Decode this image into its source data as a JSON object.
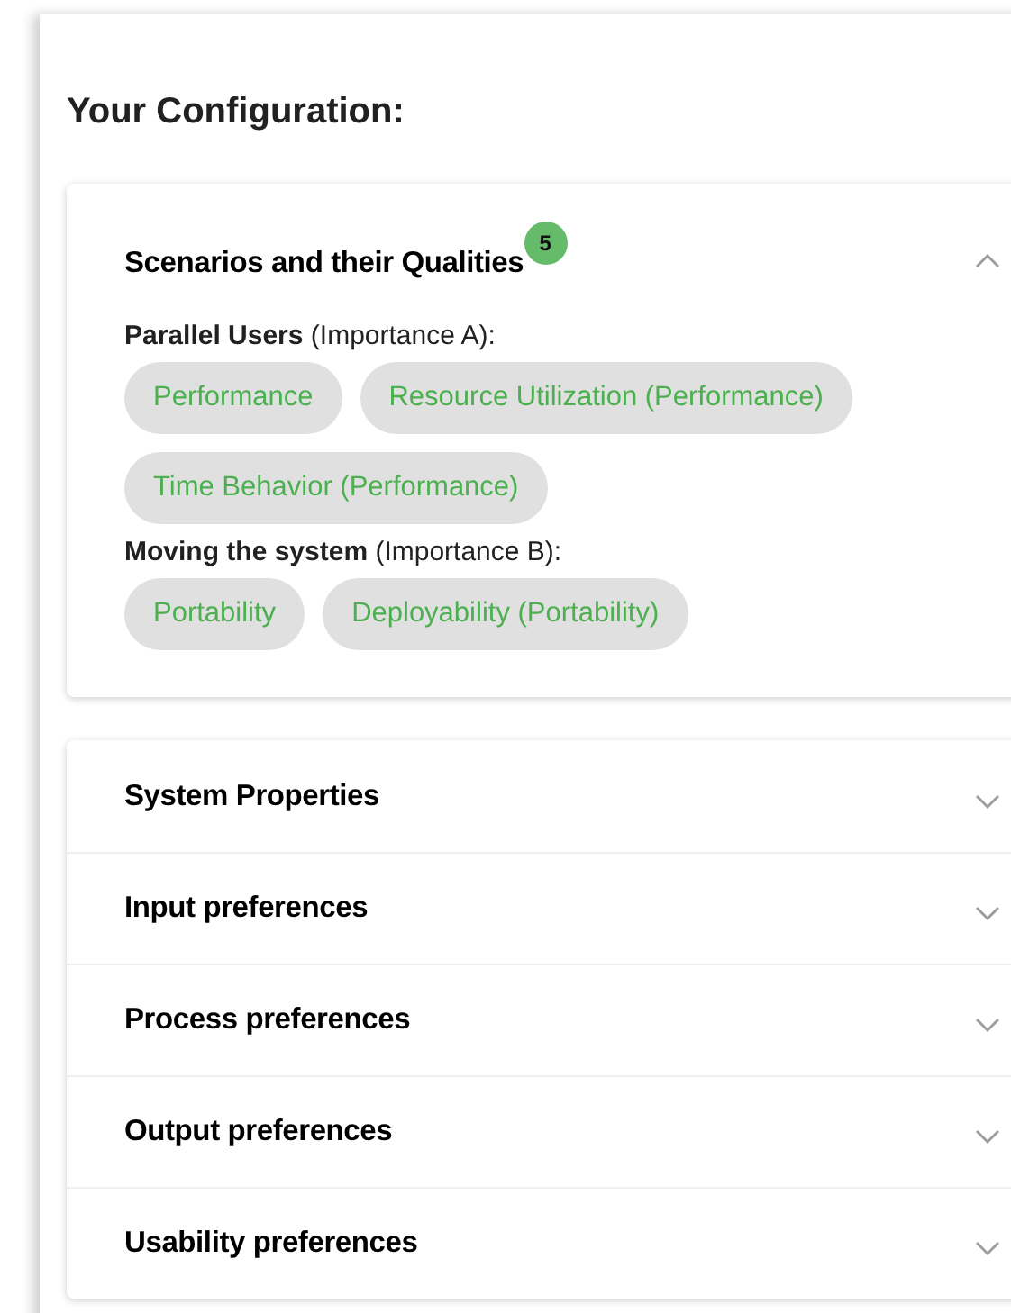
{
  "heading": "Your Configuration:",
  "open_section": {
    "title": "Scenarios and their Qualities",
    "badge": "5",
    "expanded": true,
    "scenarios": [
      {
        "label": "**Parallel Users** (Importance A):",
        "qualities": [
          "Performance",
          "Resource Utilization (Performance)",
          "Time Behavior (Performance)"
        ]
      },
      {
        "label": "**Moving the system** (Importance B):",
        "qualities": [
          "Portability",
          "Deployability (Portability)"
        ]
      }
    ]
  },
  "sections": [
    {
      "title": "System Properties",
      "expanded": false
    },
    {
      "title": "Input preferences",
      "expanded": false
    },
    {
      "title": "Process preferences",
      "expanded": false
    },
    {
      "title": "Output preferences",
      "expanded": false
    },
    {
      "title": "Usability preferences",
      "expanded": false
    }
  ]
}
